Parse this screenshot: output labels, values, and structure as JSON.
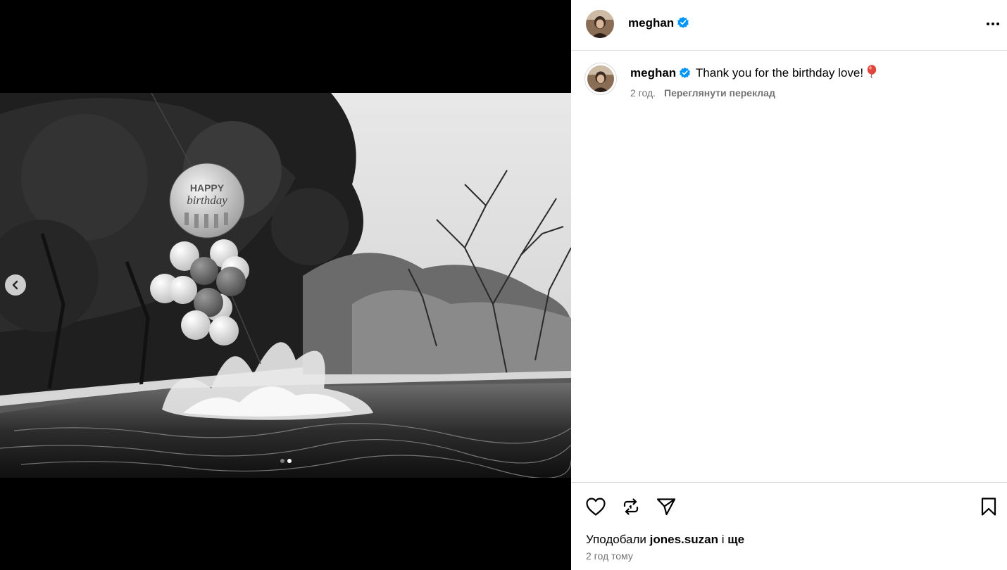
{
  "post": {
    "username": "meghan",
    "verified_icon": "verified-badge-icon",
    "more_icon": "more-options-icon",
    "caption_text": "Thank you for the birthday love!",
    "caption_emoji_icon": "balloon-icon",
    "relative_time": "2 год.",
    "see_translation": "Переглянути переклад",
    "likes_prefix": "Уподобали",
    "likes_user": "jones.suzan",
    "likes_conjunction": "і",
    "likes_more": "ще",
    "timestamp": "2 год тому"
  },
  "media": {
    "prev_icon": "chevron-left-icon",
    "carousel_total": 2,
    "carousel_current": 2,
    "balloon_text": "HAPPY birthday"
  },
  "actions": {
    "like_icon": "heart-icon",
    "repost_icon": "repost-icon",
    "share_icon": "send-icon",
    "save_icon": "bookmark-icon"
  },
  "colors": {
    "verified": "#0095f6",
    "secondary_text": "#737373",
    "divider": "#dbdbdb",
    "balloon_emoji": "#e0463c"
  }
}
